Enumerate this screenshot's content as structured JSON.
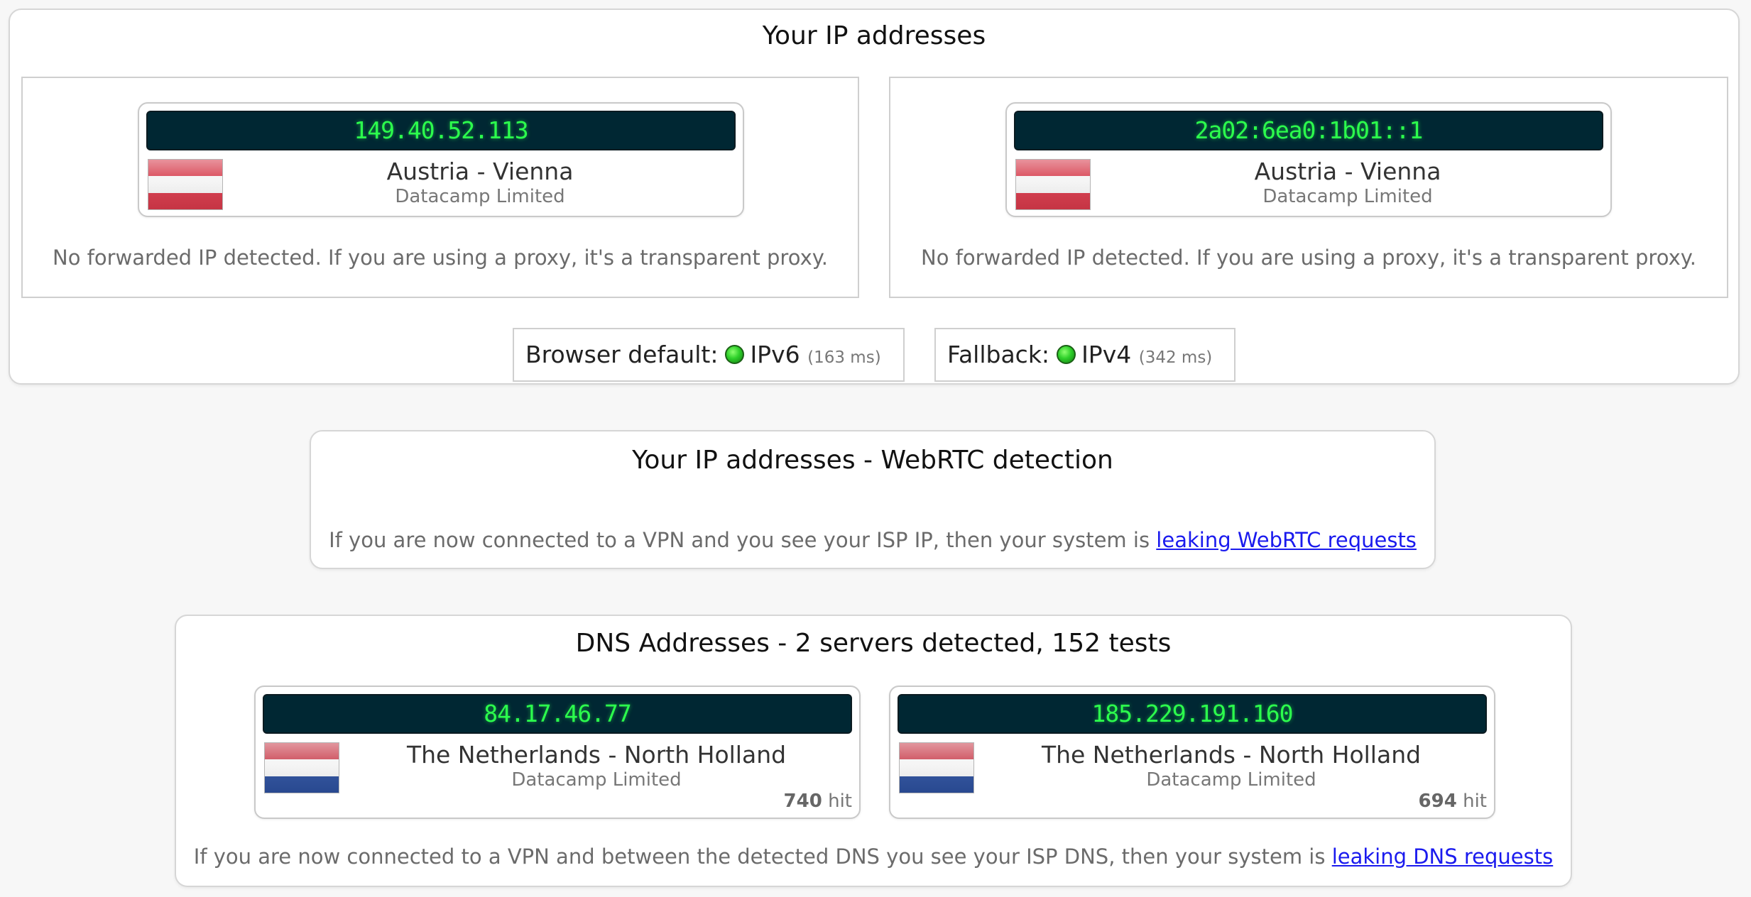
{
  "ip_panel": {
    "title": "Your IP addresses",
    "entries": [
      {
        "ip": "149.40.52.113",
        "location": "Austria - Vienna",
        "isp": "Datacamp Limited",
        "note": "No forwarded IP detected. If you are using a proxy, it's a transparent proxy.",
        "flag": "austria-flag"
      },
      {
        "ip": "2a02:6ea0:1b01::1",
        "location": "Austria - Vienna",
        "isp": "Datacamp Limited",
        "note": "No forwarded IP detected. If you are using a proxy, it's a transparent proxy.",
        "flag": "austria-flag"
      }
    ],
    "browser_default": {
      "label": "Browser default:",
      "protocol": "IPv6",
      "latency": "(163 ms)",
      "status_color": "#2ed02a"
    },
    "fallback": {
      "label": "Fallback:",
      "protocol": "IPv4",
      "latency": "(342 ms)",
      "status_color": "#2ed02a"
    }
  },
  "webrtc_panel": {
    "title": "Your IP addresses - WebRTC detection",
    "note_text": "If you are now connected to a VPN and you see your ISP IP, then your system is ",
    "link_text": "leaking WebRTC requests"
  },
  "dns_panel": {
    "title": "DNS Addresses - 2 servers detected, 152 tests",
    "servers": [
      {
        "ip": "84.17.46.77",
        "location": "The Netherlands - North Holland",
        "isp": "Datacamp Limited",
        "hits": "740",
        "hits_label": "hit",
        "flag": "netherlands-flag"
      },
      {
        "ip": "185.229.191.160",
        "location": "The Netherlands - North Holland",
        "isp": "Datacamp Limited",
        "hits": "694",
        "hits_label": "hit",
        "flag": "netherlands-flag"
      }
    ],
    "note_text": "If you are now connected to a VPN and between the detected DNS you see your ISP DNS, then your system is ",
    "link_text": "leaking DNS requests"
  },
  "colors": {
    "austria_red": "#d6394a",
    "austria_white": "#f4f4f4",
    "nl_red": "#c9404e",
    "nl_white": "#f4f4f4",
    "nl_blue": "#2c4f9c",
    "ip_bar_bg": "#002733",
    "ip_text": "#2cff4d",
    "link": "#1a1aee"
  }
}
